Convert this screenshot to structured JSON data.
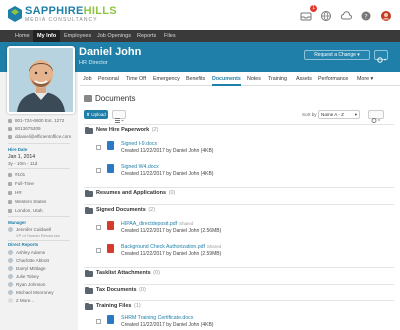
{
  "brand": {
    "name_a": "SAPPHIRE",
    "name_b": "HILLS",
    "sub": "MEDIA CONSULTANCY",
    "primary_color": "#1f7fa8",
    "accent_color": "#8cc63f"
  },
  "header_icons": [
    {
      "name": "inbox-icon",
      "badge": "1"
    },
    {
      "name": "globe-icon"
    },
    {
      "name": "cloud-icon"
    },
    {
      "name": "help-icon"
    },
    {
      "name": "user-menu-icon"
    }
  ],
  "nav": [
    {
      "label": "Home"
    },
    {
      "label": "My Info",
      "active": true
    },
    {
      "label": "Employees"
    },
    {
      "label": "Job Openings"
    },
    {
      "label": "Reports"
    },
    {
      "label": "Files"
    }
  ],
  "profile": {
    "name": "Daniel John",
    "title": "HR Director",
    "request_button": "Request a Change ▾"
  },
  "contact": {
    "work_phone": "801-724-6600 Ext. 1272",
    "mobile": "8013675309",
    "email": "ddaniel@efficientoffice.com"
  },
  "hire_date": {
    "label": "Hire Date",
    "value": "Jan 1, 2014",
    "duration": "3y - 10m - 11d"
  },
  "job_details": [
    "#101",
    "Full-Time",
    "HR",
    "Western States",
    "London, Utah"
  ],
  "manager": {
    "label": "Manager",
    "name": "Jennifer Caldwell",
    "role": "VP of Human Resources"
  },
  "direct_reports": {
    "label": "Direct Reports",
    "people": [
      "Ashley Adams",
      "Charlotte Abbott",
      "Darryl Mittlage",
      "Julie Tobey",
      "Ryan Johnson",
      "Michael Monroney"
    ],
    "more": "2 More..."
  },
  "tabs": [
    {
      "label": "Job"
    },
    {
      "label": "Personal"
    },
    {
      "label": "Time Off"
    },
    {
      "label": "Emergency"
    },
    {
      "label": "Benefits"
    },
    {
      "label": "Documents",
      "active": true
    },
    {
      "label": "Notes"
    },
    {
      "label": "Training"
    },
    {
      "label": "Assets"
    },
    {
      "label": "Performance"
    },
    {
      "label": "More ▾"
    }
  ],
  "documents": {
    "title": "Documents",
    "upload_label": "Upload",
    "sort_label": "Sort by",
    "sort_value": "Name A - Z",
    "folders": [
      {
        "name": "New Hire Paperwork",
        "count": "(2)"
      },
      {
        "name": "Resumes and Applications",
        "count": "(0)"
      },
      {
        "name": "Signed Documents",
        "count": "(2)"
      },
      {
        "name": "Tasklist Attachments",
        "count": "(0)"
      },
      {
        "name": "Tax Documents",
        "count": "(0)"
      },
      {
        "name": "Training Files",
        "count": "(1)"
      }
    ],
    "files": [
      {
        "name": "Signed I-9.docx",
        "type": "word",
        "shared": "",
        "meta": "Created 11/22/2017 by Daniel John (4KB)"
      },
      {
        "name": "Signed W4.docx",
        "type": "word",
        "shared": "",
        "meta": "Created 11/22/2017 by Daniel John (4KB)"
      },
      {
        "name": "HIPAA_directdeposit.pdf",
        "type": "pdf",
        "shared": "Shared",
        "meta": "Created 11/22/2017 by Daniel John (2.56MB)"
      },
      {
        "name": "Background Check Authorization.pdf",
        "type": "pdf",
        "shared": "Shared",
        "meta": "Created 11/22/2017 by Daniel John (2.59MB)"
      },
      {
        "name": "SHRM Training Certificate.docx",
        "type": "word",
        "shared": "",
        "meta": "Created 11/22/2017 by Daniel John (4KB)"
      }
    ]
  }
}
